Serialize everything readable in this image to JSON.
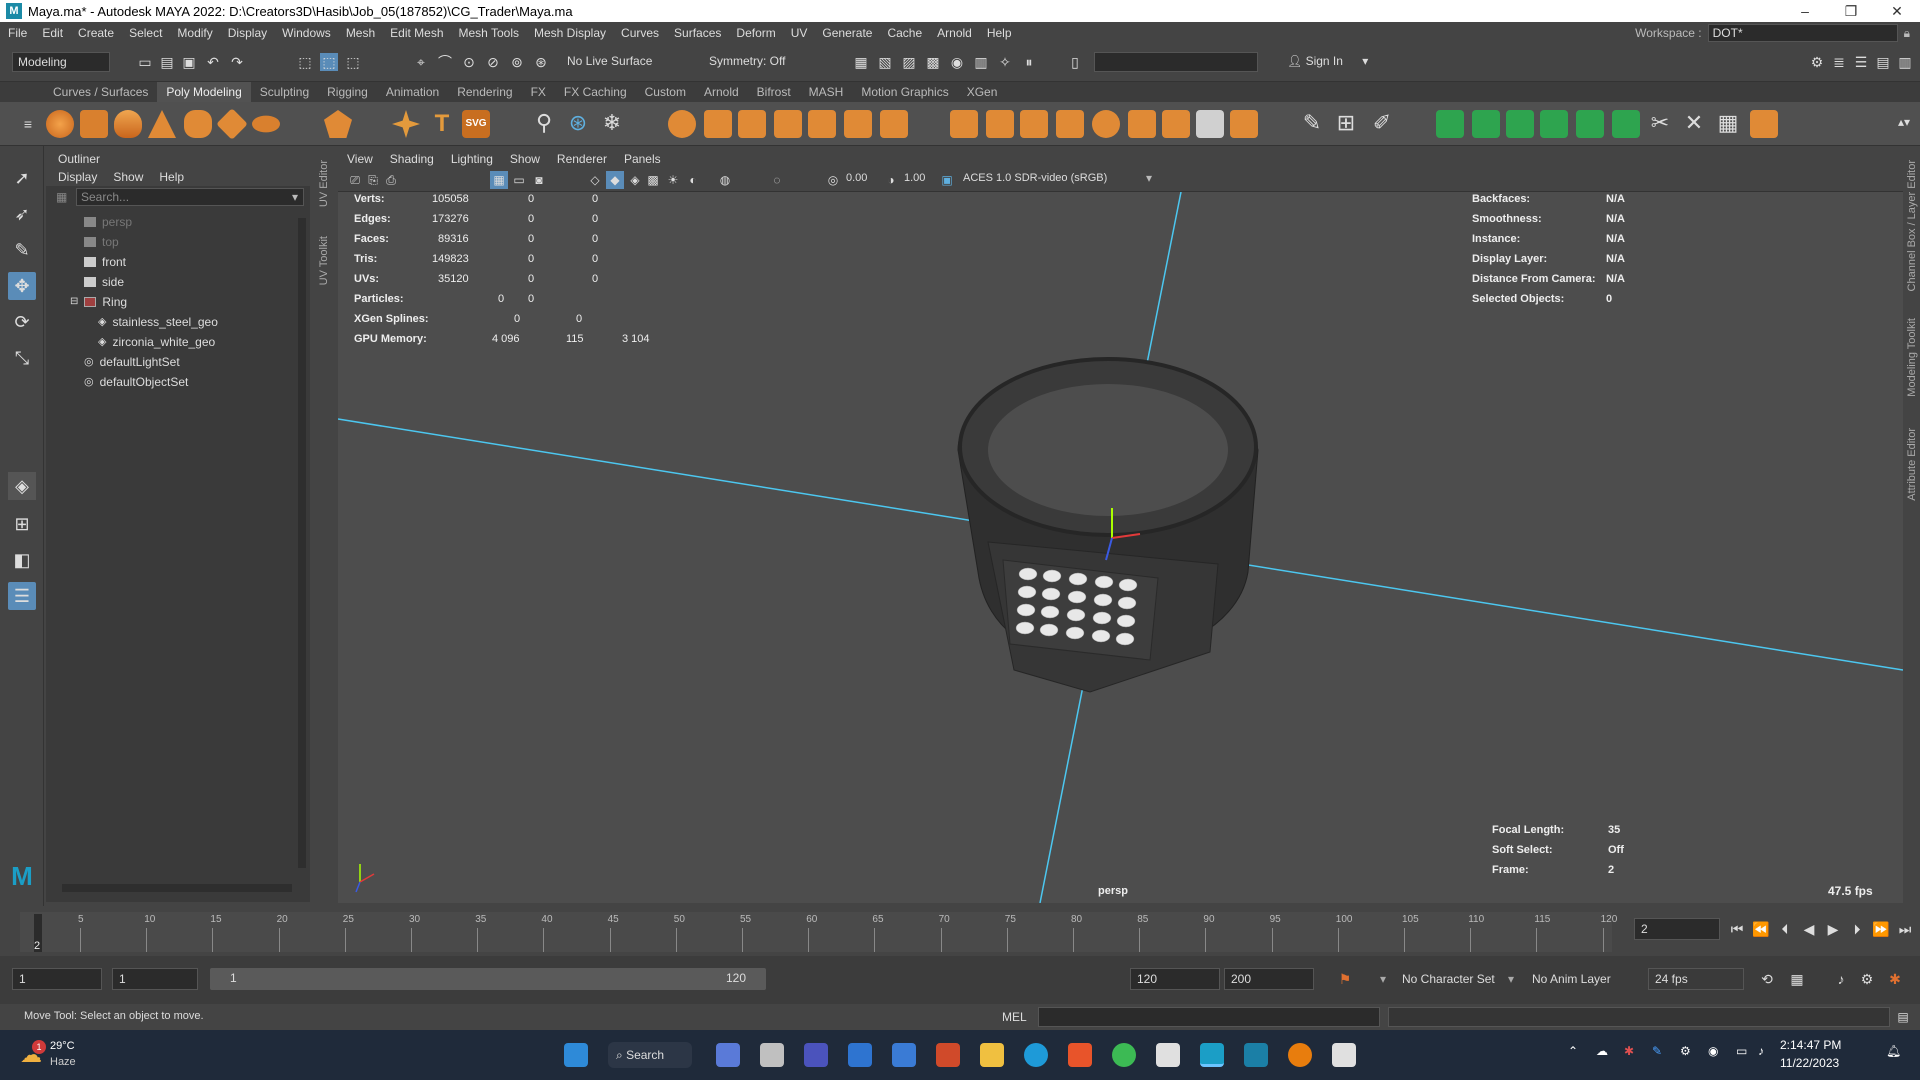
{
  "window": {
    "title": "Maya.ma* - Autodesk MAYA 2022: D:\\Creators3D\\Hasib\\Job_05(187852)\\CG_Trader\\Maya.ma",
    "controls": [
      "–",
      "❐",
      "✕"
    ]
  },
  "menubar": {
    "items": [
      "File",
      "Edit",
      "Create",
      "Select",
      "Modify",
      "Display",
      "Windows",
      "Mesh",
      "Edit Mesh",
      "Mesh Tools",
      "Mesh Display",
      "Curves",
      "Surfaces",
      "Deform",
      "UV",
      "Generate",
      "Cache",
      "Arnold",
      "Help"
    ],
    "workspace_label": "Workspace :",
    "workspace_value": "DOT*"
  },
  "statusline": {
    "mode": "Modeling",
    "live_surface": "No Live Surface",
    "symmetry": "Symmetry: Off",
    "sign_in": "Sign In"
  },
  "shelf": {
    "tabs": [
      "Curves / Surfaces",
      "Poly Modeling",
      "Sculpting",
      "Rigging",
      "Animation",
      "Rendering",
      "FX",
      "FX Caching",
      "Custom",
      "Arnold",
      "Bifrost",
      "MASH",
      "Motion Graphics",
      "XGen"
    ],
    "active_tab": "Poly Modeling",
    "svg_label": "SVG",
    "text_label": "T"
  },
  "outliner": {
    "title": "Outliner",
    "menu": [
      "Display",
      "Show",
      "Help"
    ],
    "search_placeholder": "Search...",
    "items": [
      {
        "label": "persp",
        "dim": true
      },
      {
        "label": "top",
        "dim": true
      },
      {
        "label": "front",
        "dim": false
      },
      {
        "label": "side",
        "dim": false
      },
      {
        "label": "Ring",
        "dim": false
      },
      {
        "label": "stainless_steel_geo",
        "dim": false
      },
      {
        "label": "zirconia_white_geo",
        "dim": false
      },
      {
        "label": "defaultLightSet",
        "dim": false
      },
      {
        "label": "defaultObjectSet",
        "dim": false
      }
    ]
  },
  "side_tabs": {
    "left": [
      "UV Editor",
      "UV Toolkit"
    ],
    "right": [
      "Channel Box / Layer Editor",
      "Modeling Toolkit",
      "Attribute Editor"
    ]
  },
  "viewport": {
    "menu": [
      "View",
      "Shading",
      "Lighting",
      "Show",
      "Renderer",
      "Panels"
    ],
    "exposure": "0.00",
    "gamma": "1.00",
    "color_space": "ACES 1.0 SDR-video (sRGB)",
    "hud_left": [
      {
        "label": "Verts:",
        "v1": "105058",
        "v2": "0",
        "v3": "0"
      },
      {
        "label": "Edges:",
        "v1": "173276",
        "v2": "0",
        "v3": "0"
      },
      {
        "label": "Faces:",
        "v1": "89316",
        "v2": "0",
        "v3": "0"
      },
      {
        "label": "Tris:",
        "v1": "149823",
        "v2": "0",
        "v3": "0"
      },
      {
        "label": "UVs:",
        "v1": "35120",
        "v2": "0",
        "v3": "0"
      },
      {
        "label": "Particles:",
        "v1": "",
        "v2": "0",
        "v3": "0"
      },
      {
        "label": "XGen Splines:",
        "v1": "",
        "v2": "0",
        "v3": "0"
      },
      {
        "label": "GPU Memory:",
        "v1": "4 096",
        "v2": "115",
        "v3": "3 104"
      }
    ],
    "hud_right": [
      {
        "label": "Backfaces:",
        "value": "N/A"
      },
      {
        "label": "Smoothness:",
        "value": "N/A"
      },
      {
        "label": "Instance:",
        "value": "N/A"
      },
      {
        "label": "Display Layer:",
        "value": "N/A"
      },
      {
        "label": "Distance From Camera:",
        "value": "N/A"
      },
      {
        "label": "Selected Objects:",
        "value": "0"
      }
    ],
    "hud_bottom": [
      {
        "label": "Focal Length:",
        "value": "35"
      },
      {
        "label": "Soft Select:",
        "value": "Off"
      },
      {
        "label": "Frame:",
        "value": "2"
      }
    ],
    "fps": "47.5 fps",
    "camera": "persp"
  },
  "timeline": {
    "ticks": [
      "5",
      "10",
      "15",
      "20",
      "25",
      "30",
      "35",
      "40",
      "45",
      "50",
      "55",
      "60",
      "65",
      "70",
      "75",
      "80",
      "85",
      "90",
      "95",
      "100",
      "105",
      "110",
      "115",
      "120"
    ],
    "current_frame": "2",
    "current_marker": "2"
  },
  "range": {
    "start": "1",
    "anim_start": "1",
    "slider_start": "1",
    "slider_end": "120",
    "end": "120",
    "anim_end": "200",
    "character_set": "No Character Set",
    "anim_layer": "No Anim Layer",
    "fps": "24 fps"
  },
  "cmdline": {
    "help": "Move Tool: Select an object to move.",
    "lang": "MEL"
  },
  "taskbar": {
    "weather_temp": "29°C",
    "weather_desc": "Haze",
    "search": "Search",
    "time": "2:14:47 PM",
    "date": "11/22/2023",
    "badge": "1"
  }
}
